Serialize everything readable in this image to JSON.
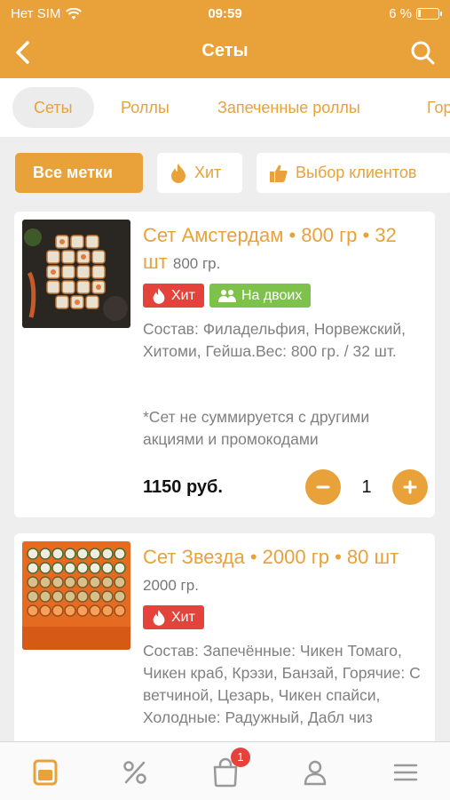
{
  "status_bar": {
    "carrier": "Нет SIM",
    "time": "09:59",
    "battery": "6 %"
  },
  "nav": {
    "title": "Сеты"
  },
  "categories": [
    "Сеты",
    "Роллы",
    "Запеченные роллы",
    "Горячие"
  ],
  "filters": {
    "all": "Все метки",
    "hit": "Хит",
    "clients": "Выбор клиентов"
  },
  "products": [
    {
      "title": "Сет Амстердам • 800 гр • 32 шт",
      "weight": "800 гр.",
      "badges": [
        "Хит",
        "На двоих"
      ],
      "composition": "Состав: Филадельфия, Норвежский, Хитоми, Гейша.Вес: 800 гр. / 32 шт.",
      "note": "*Сет не суммируется с другими акциями и промокодами",
      "price": "1150 руб.",
      "quantity": "1"
    },
    {
      "title": "Сет Звезда • 2000 гр • 80 шт",
      "weight": "2000 гр.",
      "badges": [
        "Хит"
      ],
      "composition": "Состав: Запечённые: Чикен Томаго, Чикен краб, Крэзи, Банзай, Горячие: С ветчиной, Цезарь, Чикен спайси, Холодные: Радужный, Дабл чиз"
    }
  ],
  "tabbar": {
    "cart_count": "1"
  },
  "colors": {
    "accent": "#e9a139",
    "hit": "#e3433a",
    "duo": "#7ec24c"
  }
}
